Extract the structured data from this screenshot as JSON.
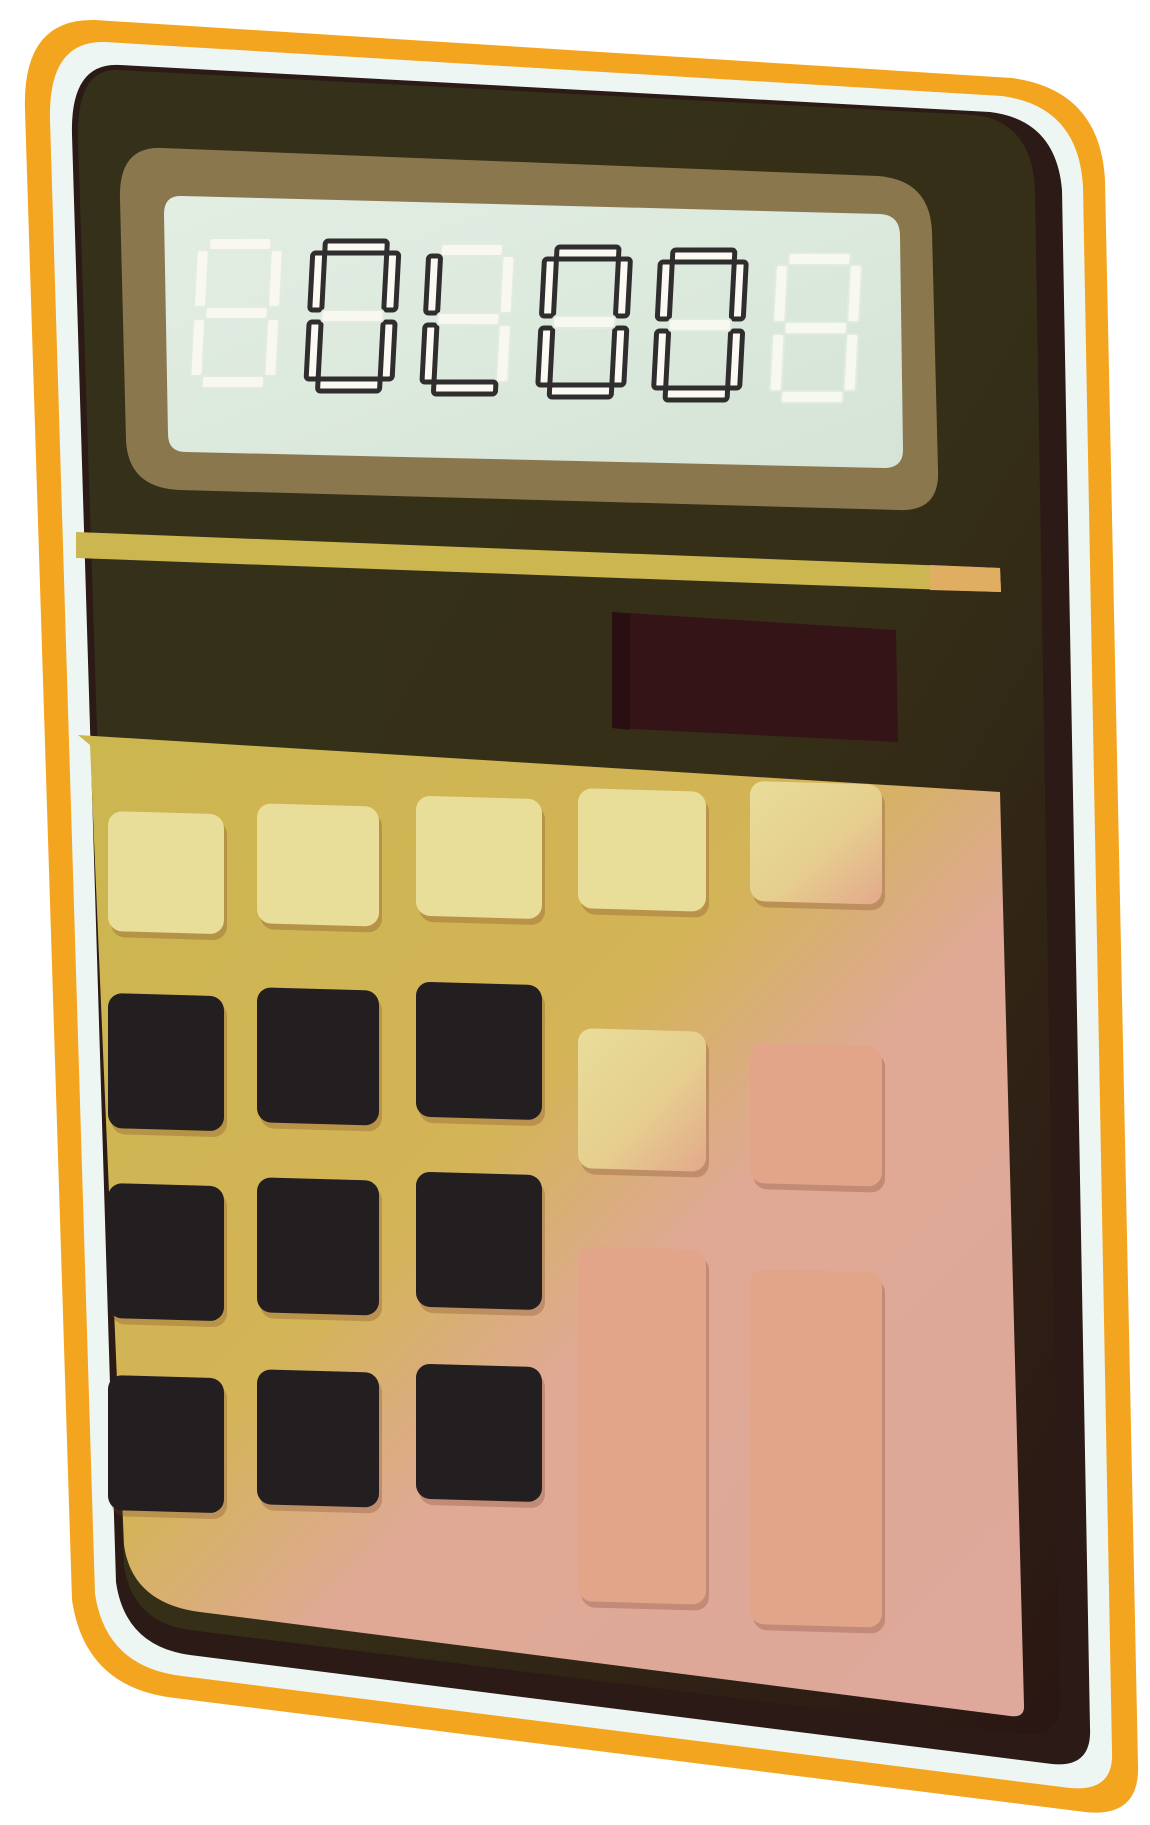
{
  "illustration": {
    "subject": "calculator-icon",
    "display": {
      "digits": [
        "8",
        "0",
        "L",
        "0",
        "0",
        "8"
      ],
      "digit_colors": {
        "lit": "#2f2d2e",
        "ghost": "#fbfaf2",
        "screen": "#d8e6da"
      }
    },
    "colors": {
      "outer_border": "#f4a51f",
      "inner_border": "#eef6f3",
      "body": "#352f17",
      "body_shadow": "#2b1a15",
      "bezel": "#8b774e",
      "stripe": "#cbb650",
      "solar_panel": "#341417",
      "keypad_top": "#cdb54d",
      "keypad_bottom": "#dea89b",
      "key_light": "#e8dd99",
      "key_dark": "#231f20",
      "key_peach": "#e2a589"
    },
    "keys": {
      "top_row": 5,
      "number_grid": 9,
      "operator_small": 2,
      "operator_tall": 2
    }
  }
}
